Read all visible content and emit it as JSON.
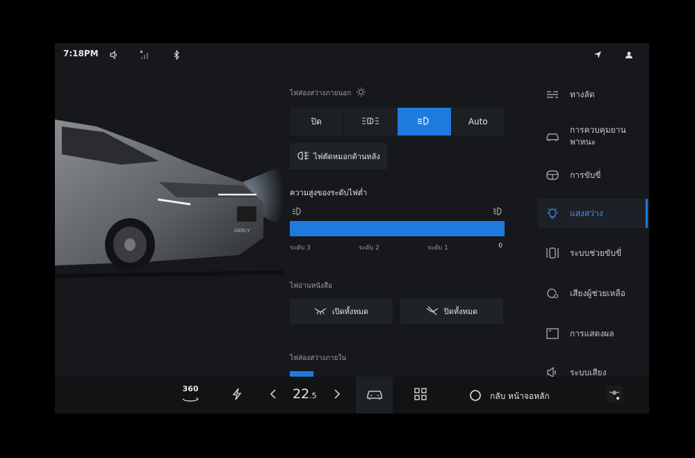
{
  "status_bar": {
    "time": "7:18PM",
    "icons": [
      "mute-volume-icon",
      "no-signal-icon",
      "bluetooth-icon",
      "navigation-icon",
      "profile-icon"
    ]
  },
  "exterior_lighting": {
    "title": "ไฟส่องสว่างภายนอก",
    "modes": [
      {
        "label": "ปิด",
        "icon": "",
        "active": false
      },
      {
        "label": "",
        "icon": "parking-light-icon",
        "active": false
      },
      {
        "label": "",
        "icon": "low-beam-icon",
        "active": true
      },
      {
        "label": "Auto",
        "icon": "",
        "active": false
      }
    ],
    "rear_fog_label": "ไฟตัดหมอกด้านหลัง"
  },
  "beam_height": {
    "title": "ความสูงของระดับไฟต่ำ",
    "levels": [
      "ระดับ 3",
      "ระดับ 2",
      "ระดับ 1",
      "0"
    ],
    "value": 1.0
  },
  "reading_lights": {
    "title": "ไฟอ่านหนังสือ",
    "all_on_label": "เปิดทั้งหมด",
    "all_off_label": "ปิดทั้งหมด"
  },
  "interior_lighting": {
    "title": "ไฟส่องสว่างภายใน"
  },
  "side_menu": {
    "items": [
      {
        "label": "ทางลัด",
        "icon": "shortcut-icon",
        "active": false
      },
      {
        "label": "การควบคุมยาน\nพาหนะ",
        "icon": "vehicle-control-icon",
        "active": false
      },
      {
        "label": "การขับขี่",
        "icon": "steering-wheel-icon",
        "active": false
      },
      {
        "label": "แสงสว่าง",
        "icon": "light-bulb-icon",
        "active": true
      },
      {
        "label": "ระบบช่วยขับขี่",
        "icon": "driver-assist-icon",
        "active": false
      },
      {
        "label": "เสียงผู้ช่วยเหลือ",
        "icon": "voice-assistant-icon",
        "active": false
      },
      {
        "label": "การแสดงผล",
        "icon": "display-icon",
        "active": false
      },
      {
        "label": "ระบบเสียง",
        "icon": "sound-icon",
        "active": false
      }
    ]
  },
  "dock": {
    "camera_label": "360",
    "temperature_main": "22",
    "temperature_decimal": ".5",
    "home_label": "กลับ หน้าจอหลัก"
  },
  "colors": {
    "accent": "#1f7ae0",
    "background": "#16181b"
  }
}
